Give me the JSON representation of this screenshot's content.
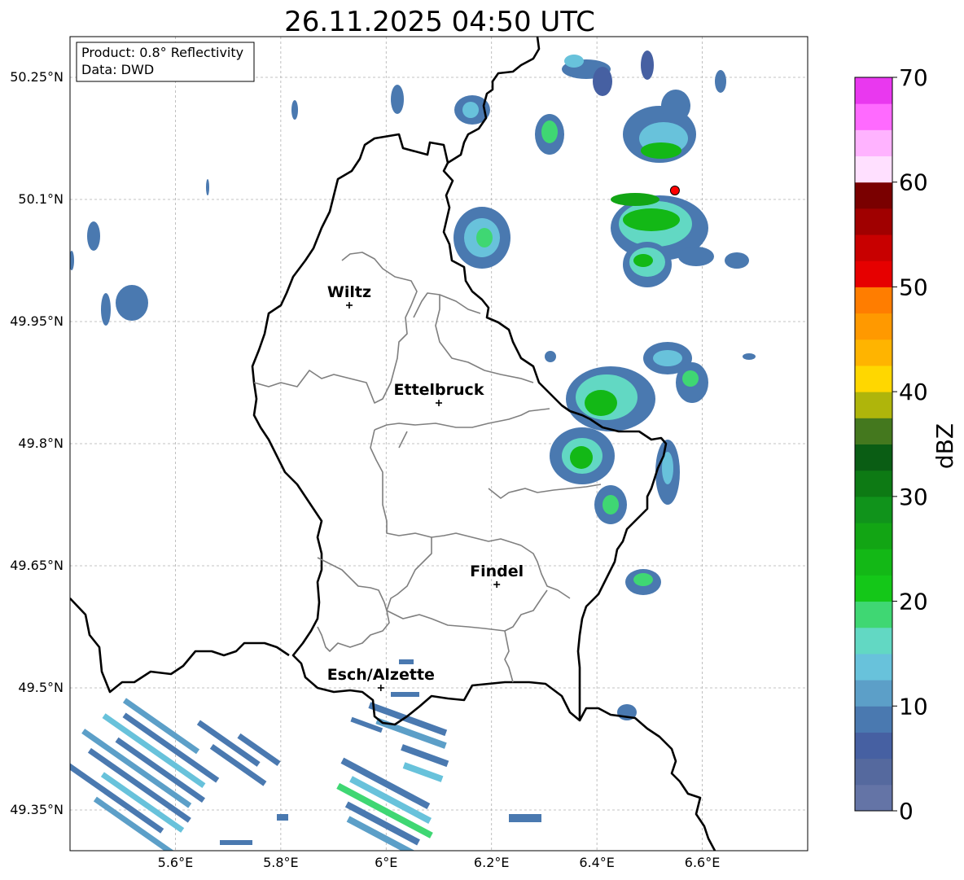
{
  "title": "26.11.2025 04:50 UTC",
  "info_box": {
    "product": "Product: 0.8° Reflectivity",
    "data": "Data: DWD"
  },
  "map": {
    "lon_range": [
      5.4,
      6.8
    ],
    "lat_range": [
      49.3,
      50.3
    ],
    "x_ticks": [
      {
        "value": 5.6,
        "label": "5.6°E"
      },
      {
        "value": 5.8,
        "label": "5.8°E"
      },
      {
        "value": 6.0,
        "label": "6°E"
      },
      {
        "value": 6.2,
        "label": "6.2°E"
      },
      {
        "value": 6.4,
        "label": "6.4°E"
      },
      {
        "value": 6.6,
        "label": "6.6°E"
      }
    ],
    "y_ticks": [
      {
        "value": 49.35,
        "label": "49.35°N"
      },
      {
        "value": 49.5,
        "label": "49.5°N"
      },
      {
        "value": 49.65,
        "label": "49.65°N"
      },
      {
        "value": 49.8,
        "label": "49.8°N"
      },
      {
        "value": 49.95,
        "label": "49.95°N"
      },
      {
        "value": 50.1,
        "label": "50.1°N"
      },
      {
        "value": 50.25,
        "label": "50.25°N"
      }
    ],
    "grid": true,
    "cities": [
      {
        "name": "Wiltz",
        "lon": 5.93,
        "lat": 49.97
      },
      {
        "name": "Ettelbruck",
        "lon": 6.1,
        "lat": 49.85
      },
      {
        "name": "Findel",
        "lon": 6.21,
        "lat": 49.627
      },
      {
        "name": "Esch/Alzette",
        "lon": 5.99,
        "lat": 49.5
      }
    ],
    "radar_site": {
      "lon": 6.548,
      "lat": 50.111,
      "color": "#ff0000"
    }
  },
  "colorbar": {
    "label": "dBZ",
    "min": 0,
    "max": 70,
    "ticks": [
      0,
      10,
      20,
      30,
      40,
      50,
      60,
      70
    ],
    "colors": [
      "#6474a6",
      "#55699e",
      "#4660a2",
      "#4a79b0",
      "#5c9fc8",
      "#68c2db",
      "#62d8c3",
      "#3fd773",
      "#14c718",
      "#13b816",
      "#12a514",
      "#10931b",
      "#0d7a14",
      "#0a5d14",
      "#44781e",
      "#afb50b",
      "#ffd700",
      "#ffb400",
      "#ff9900",
      "#ff7d00",
      "#e60000",
      "#c80000",
      "#a00000",
      "#7a0000",
      "#ffe0ff",
      "#ffb3ff",
      "#ff6aff",
      "#e938ef"
    ]
  }
}
